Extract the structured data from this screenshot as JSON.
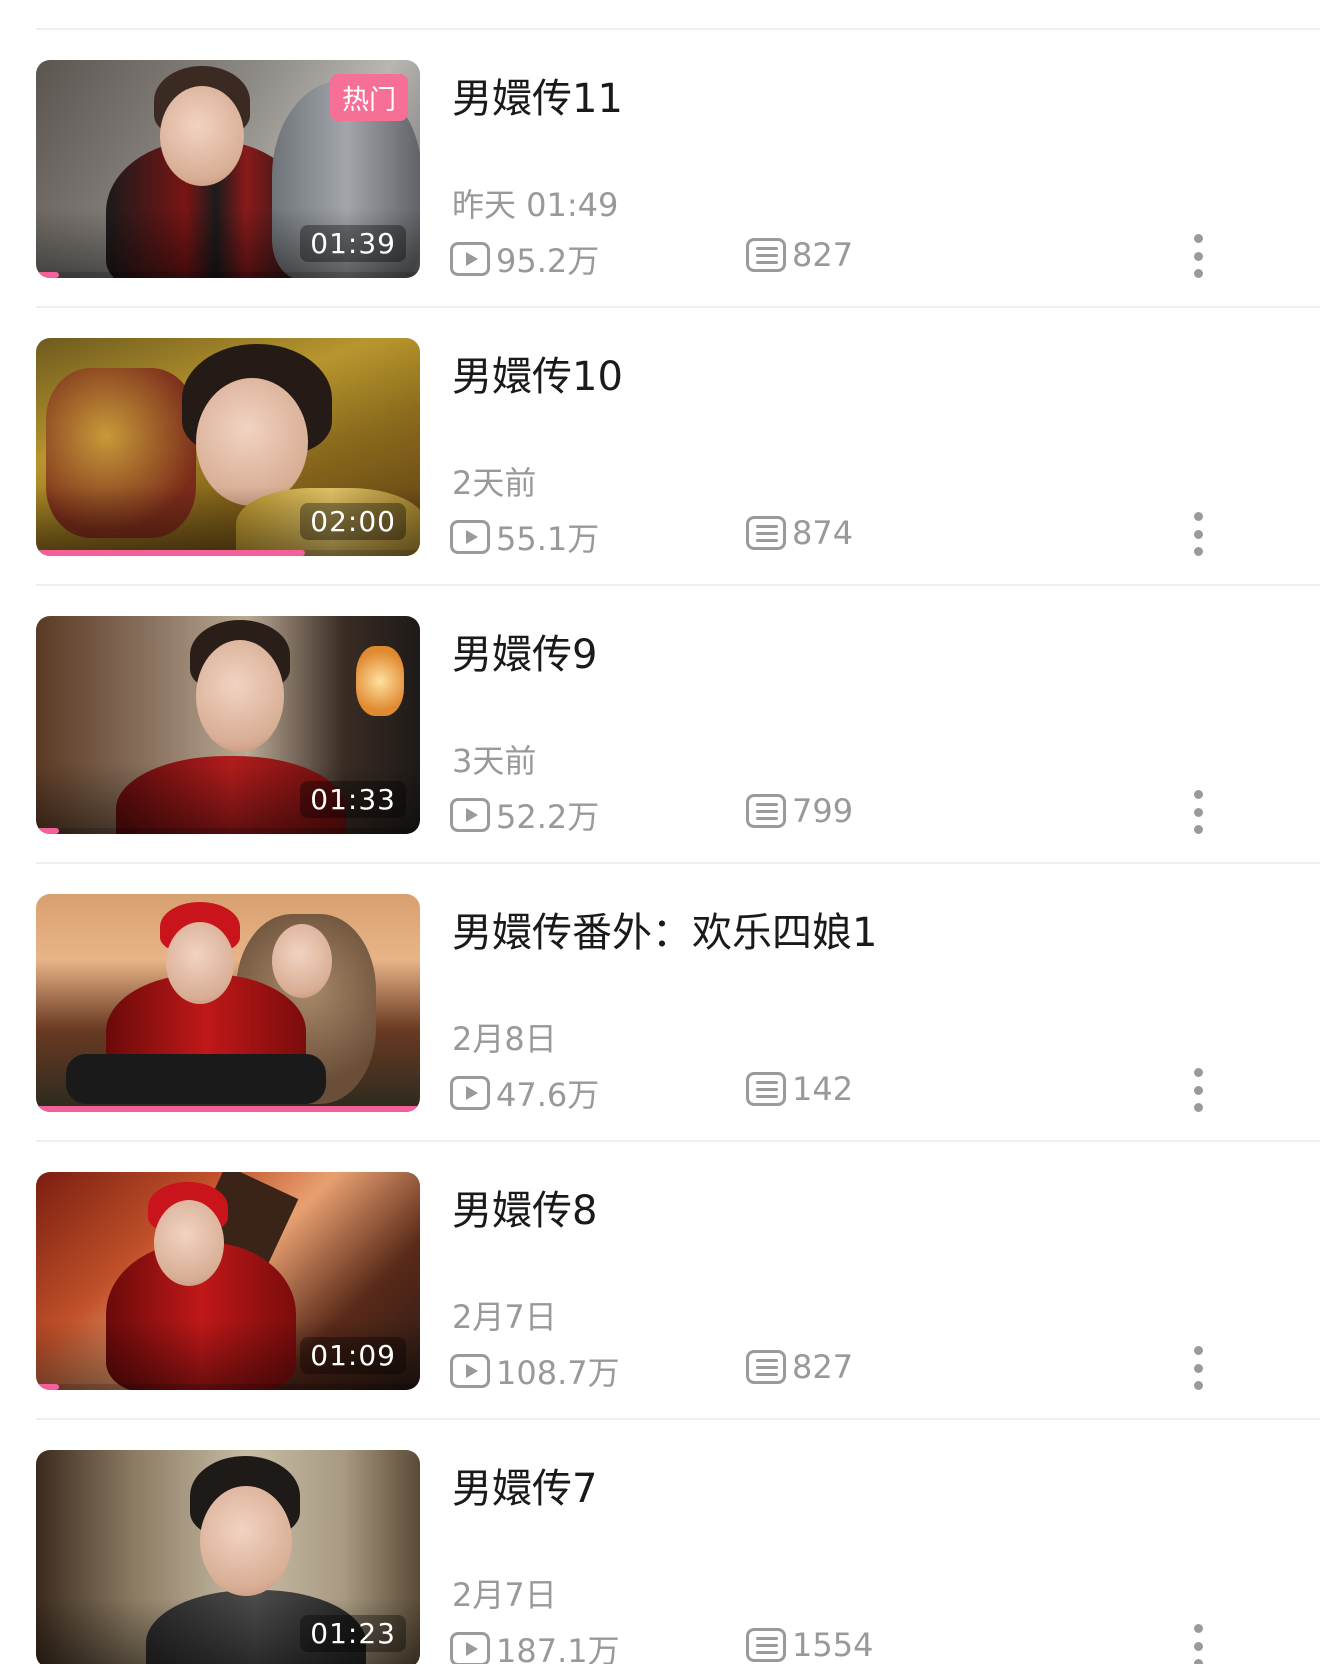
{
  "badge_hot": "热门",
  "colors": {
    "accent": "#f3609a",
    "badge": "#f56f97",
    "meta_text": "#999999",
    "title_text": "#1a1a1a"
  },
  "icons": {
    "views": "play-icon",
    "comments": "danmaku-icon",
    "more": "more-vertical-icon"
  },
  "videos": [
    {
      "title": "男嬛传11",
      "date": "昨天 01:49",
      "views": "95.2万",
      "comments": "827",
      "duration": "01:39",
      "hot": true,
      "progress": 0.06
    },
    {
      "title": "男嬛传10",
      "date": "2天前",
      "views": "55.1万",
      "comments": "874",
      "duration": "02:00",
      "hot": false,
      "progress": 0.7
    },
    {
      "title": "男嬛传9",
      "date": "3天前",
      "views": "52.2万",
      "comments": "799",
      "duration": "01:33",
      "hot": false,
      "progress": 0.06
    },
    {
      "title": "男嬛传番外：欢乐四娘1",
      "date": "2月8日",
      "views": "47.6万",
      "comments": "142",
      "duration": "",
      "hot": false,
      "progress": 1.0
    },
    {
      "title": "男嬛传8",
      "date": "2月7日",
      "views": "108.7万",
      "comments": "827",
      "duration": "01:09",
      "hot": false,
      "progress": 0.06
    },
    {
      "title": "男嬛传7",
      "date": "2月7日",
      "views": "187.1万",
      "comments": "1554",
      "duration": "01:23",
      "hot": false,
      "progress": 0
    }
  ]
}
